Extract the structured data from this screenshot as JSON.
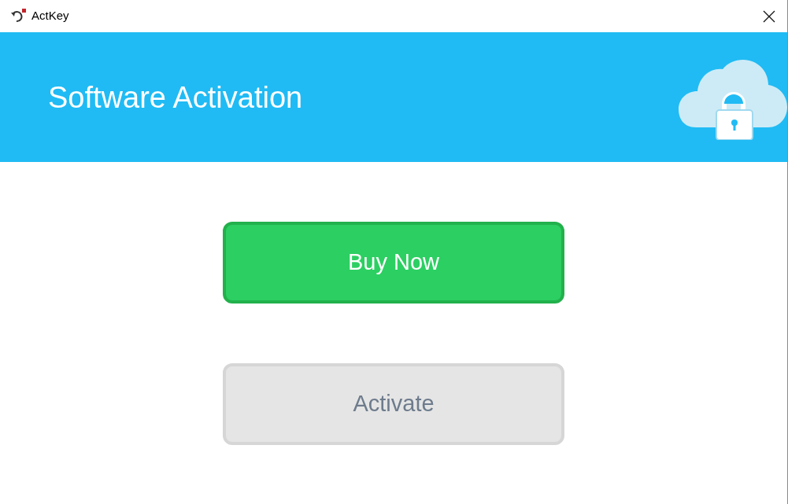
{
  "window": {
    "title": "ActKey"
  },
  "banner": {
    "title": "Software Activation"
  },
  "buttons": [
    {
      "label": "Buy Now",
      "disabled": false
    },
    {
      "label": "Activate",
      "disabled": true
    }
  ]
}
